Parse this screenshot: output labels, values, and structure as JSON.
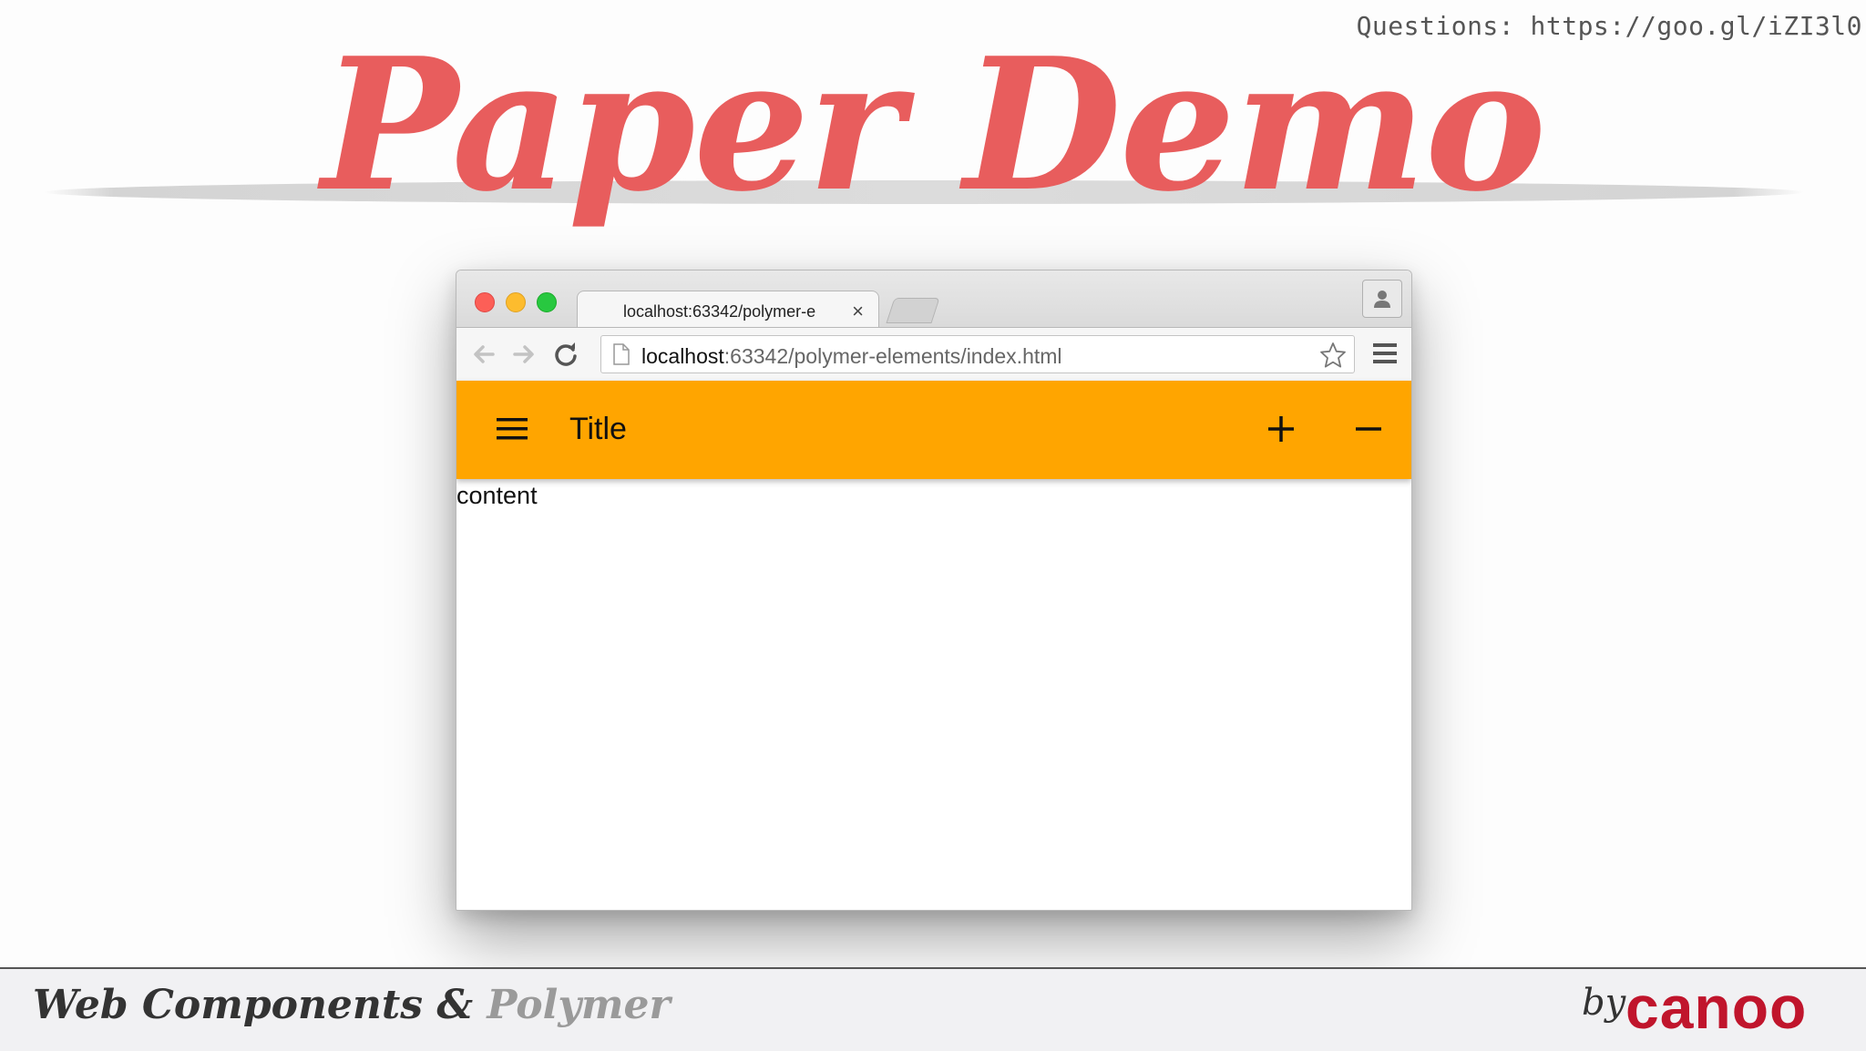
{
  "slide": {
    "title": "Paper Demo",
    "questions": "Questions: https://goo.gl/iZI3l0",
    "footer_left": "Web Components &",
    "footer_left_accent": "Polymer",
    "footer_by": "by",
    "footer_brand": "canoo",
    "colors": {
      "title": "#e85d5d",
      "brand": "#c0152c",
      "appbar": "#ffa500"
    }
  },
  "browser": {
    "tab_title": "localhost:63342/polymer-e",
    "tab_close": "×",
    "url_host": "localhost",
    "url_rest": ":63342/polymer-elements/index.html",
    "icons": [
      "back-icon",
      "forward-icon",
      "reload-icon",
      "page-icon",
      "star-icon",
      "menu-icon",
      "profile-icon"
    ]
  },
  "app": {
    "title": "Title",
    "content": "content",
    "icons": [
      "hamburger-icon",
      "plus-icon",
      "minus-icon"
    ]
  }
}
